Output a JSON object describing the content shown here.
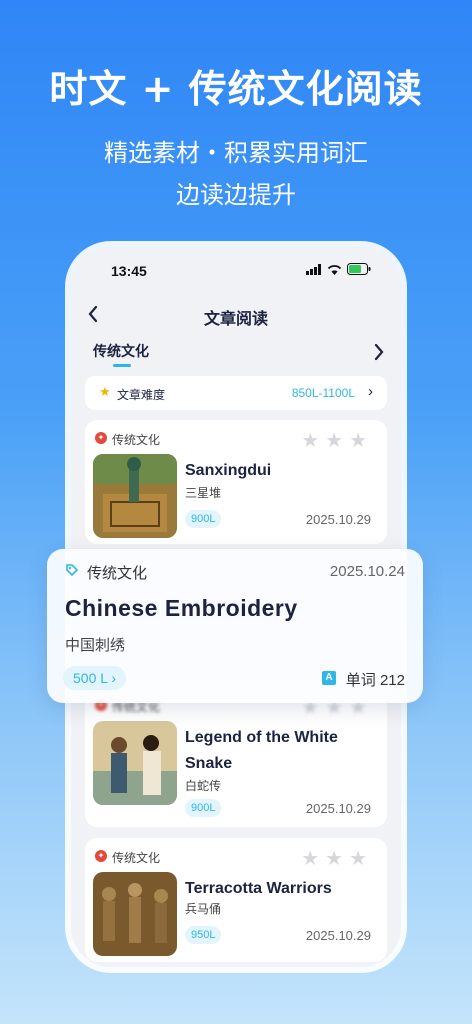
{
  "promo": {
    "headline": "时文 + 传统文化阅读",
    "subtitle_line1": "精选素材・积累实用词汇",
    "subtitle_line2": "边读边提升"
  },
  "status_bar": {
    "time": "13:45"
  },
  "nav": {
    "title": "文章阅读",
    "back_icon": "chevron-left-icon"
  },
  "tabs": [
    {
      "label": "传统文化",
      "active": true
    }
  ],
  "difficulty": {
    "label": "文章难度",
    "value": "850L-1100L"
  },
  "articles": [
    {
      "category": "传统文化",
      "title": "Sanxingdui",
      "title_cn": "三星堆",
      "level": "900L",
      "date": "2025.10.29",
      "stars": 3
    },
    {
      "category": "传统文化",
      "title": "Legend of the White Snake",
      "title_cn": "白蛇传",
      "level": "900L",
      "date": "2025.10.29",
      "stars": 3
    },
    {
      "category": "传统文化",
      "title": "Terracotta Warriors",
      "title_cn": "兵马俑",
      "level": "950L",
      "date": "2025.10.29",
      "stars": 3
    }
  ],
  "featured": {
    "category": "传统文化",
    "date": "2025.10.24",
    "title": "Chinese Embroidery",
    "title_cn": "中国刺绣",
    "level": "500 L",
    "words_label": "单词 212"
  },
  "colors": {
    "accent": "#2fb6e8",
    "background_top": "#2f86f6",
    "title_text": "#1c2340",
    "category_icon": "#e24a3b"
  }
}
